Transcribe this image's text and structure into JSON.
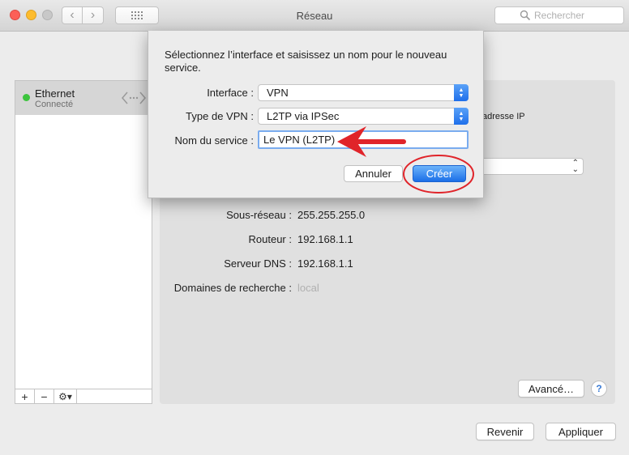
{
  "window": {
    "title": "Réseau"
  },
  "toolbar": {
    "search_placeholder": "Rechercher"
  },
  "sidebar": {
    "services": [
      {
        "name": "Ethernet",
        "status": "Connecté",
        "status_color": "#3cc43d"
      }
    ],
    "buttons": {
      "add": "+",
      "remove": "−",
      "gear": "⚙▾"
    }
  },
  "details": {
    "ip_partial": "adresse IP",
    "subnet_label": "Sous-réseau :",
    "subnet_value": "255.255.255.0",
    "router_label": "Routeur :",
    "router_value": "192.168.1.1",
    "dns_label": "Serveur DNS :",
    "dns_value": "192.168.1.1",
    "domains_label": "Domaines de recherche :",
    "domains_value": "local",
    "advanced_button": "Avancé…",
    "help_button": "?"
  },
  "footer": {
    "revert_button": "Revenir",
    "apply_button": "Appliquer"
  },
  "sheet": {
    "message": "Sélectionnez l’interface et saisissez un nom pour le nouveau service.",
    "interface_label": "Interface :",
    "interface_value": "VPN",
    "vpn_type_label": "Type de VPN :",
    "vpn_type_value": "L2TP via IPSec",
    "service_name_label": "Nom du service :",
    "service_name_value": "Le VPN (L2TP)",
    "cancel_button": "Annuler",
    "create_button": "Créer"
  },
  "annotations": {
    "color": "#e0242a"
  }
}
